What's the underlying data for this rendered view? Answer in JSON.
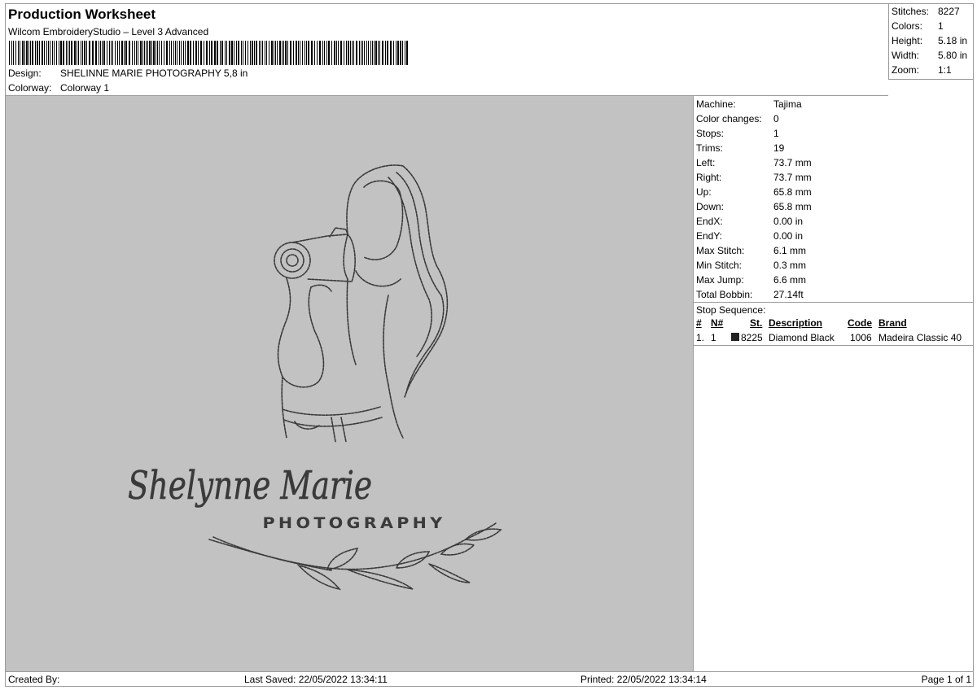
{
  "header": {
    "title": "Production Worksheet",
    "subtitle": "Wilcom EmbroideryStudio – Level 3 Advanced",
    "design_label": "Design:",
    "design_value": "SHELINNE MARIE PHOTOGRAPHY 5,8 in",
    "colorway_label": "Colorway:",
    "colorway_value": "Colorway 1"
  },
  "stats": [
    {
      "label": "Stitches:",
      "value": "8227"
    },
    {
      "label": "Colors:",
      "value": "1"
    },
    {
      "label": "Height:",
      "value": "5.18 in"
    },
    {
      "label": "Width:",
      "value": "5.80 in"
    },
    {
      "label": "Zoom:",
      "value": "1:1"
    }
  ],
  "machine_info": [
    {
      "label": "Machine:",
      "value": "Tajima"
    },
    {
      "label": "Color changes:",
      "value": "0"
    },
    {
      "label": "Stops:",
      "value": "1"
    },
    {
      "label": "Trims:",
      "value": "19"
    },
    {
      "label": "Left:",
      "value": "73.7 mm"
    },
    {
      "label": "Right:",
      "value": "73.7 mm"
    },
    {
      "label": "Up:",
      "value": "65.8 mm"
    },
    {
      "label": "Down:",
      "value": "65.8 mm"
    },
    {
      "label": "EndX:",
      "value": "0.00 in"
    },
    {
      "label": "EndY:",
      "value": "0.00 in"
    },
    {
      "label": "Max Stitch:",
      "value": "6.1 mm"
    },
    {
      "label": "Min Stitch:",
      "value": "0.3 mm"
    },
    {
      "label": "Max Jump:",
      "value": "6.6 mm"
    },
    {
      "label": "Total Bobbin:",
      "value": "27.14ft"
    }
  ],
  "stop_sequence": {
    "title": "Stop Sequence:",
    "columns": {
      "num": "#",
      "n": "N#",
      "st": "St.",
      "description": "Description",
      "code": "Code",
      "brand": "Brand"
    },
    "rows": [
      {
        "num": "1.",
        "n": "1",
        "swatch_color": "#222222",
        "st": "8225",
        "description": "Diamond Black",
        "code": "1006",
        "brand": "Madeira Classic 40"
      }
    ]
  },
  "design": {
    "text_main": "Shelynne Marie",
    "text_sub": "PHOTOGRAPHY",
    "thread_color": "#3a3a3a",
    "background_color": "#c2c2c2"
  },
  "footer": {
    "created_by": "Created By:",
    "last_saved": "Last Saved: 22/05/2022 13:34:11",
    "printed": "Printed: 22/05/2022 13:34:14",
    "page": "Page 1 of 1"
  }
}
